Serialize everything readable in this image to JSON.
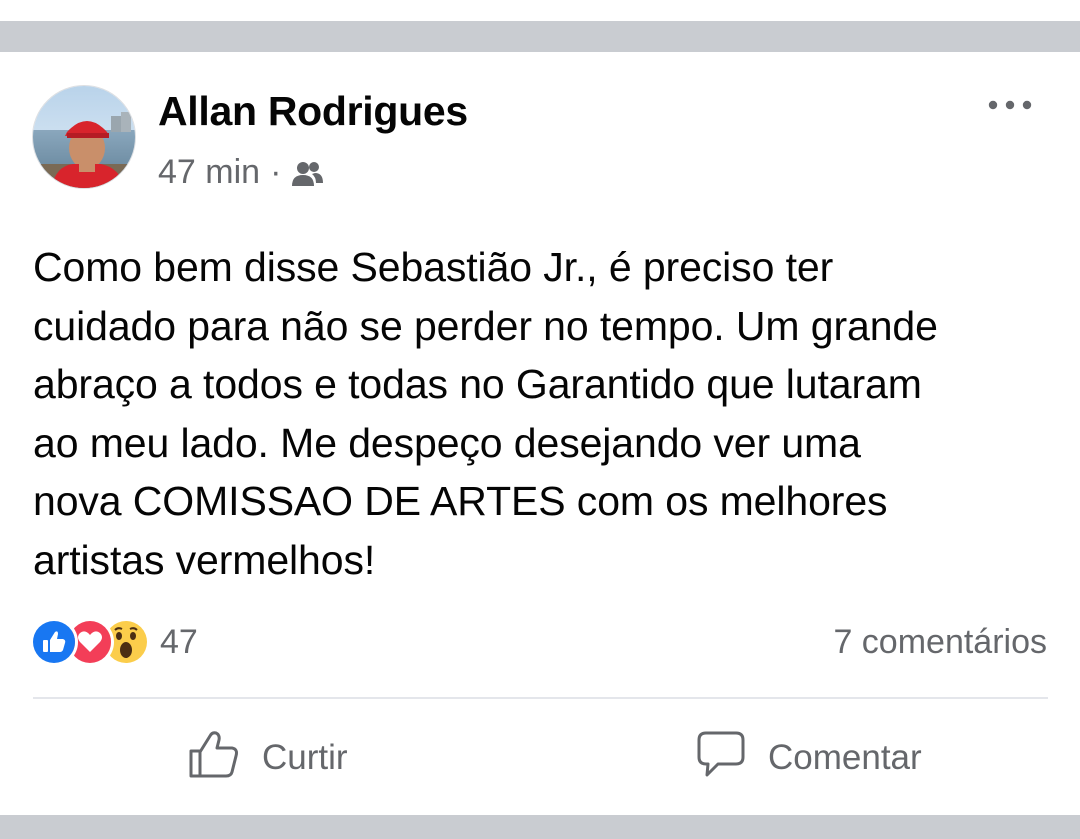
{
  "post": {
    "author": "Allan Rodrigues",
    "time": "47 min",
    "separator": "·",
    "audience_icon": "friends-icon",
    "more_icon": "more-options-icon",
    "text": "Como bem disse Sebastião Jr., é preciso ter\ncuidado para não se perder no tempo. Um grande\nabraço a todos e todas no Garantido que lutaram\nao meu lado. Me despeço desejando ver uma\nnova COMISSAO DE ARTES com os melhores\nartistas vermelhos!"
  },
  "reactions": {
    "types": [
      "like",
      "love",
      "wow"
    ],
    "count": "47"
  },
  "comments": {
    "label": "7 comentários"
  },
  "actions": {
    "like_label": "Curtir",
    "like_icon": "thumbs-up-icon",
    "comment_label": "Comentar",
    "comment_icon": "speech-bubble-icon"
  },
  "colors": {
    "separator": "#c9ccd1",
    "secondary_text": "#65676b",
    "like_blue": "#1877f2",
    "love_red": "#f33e58",
    "wow_yellow": "#fbcd4b"
  }
}
